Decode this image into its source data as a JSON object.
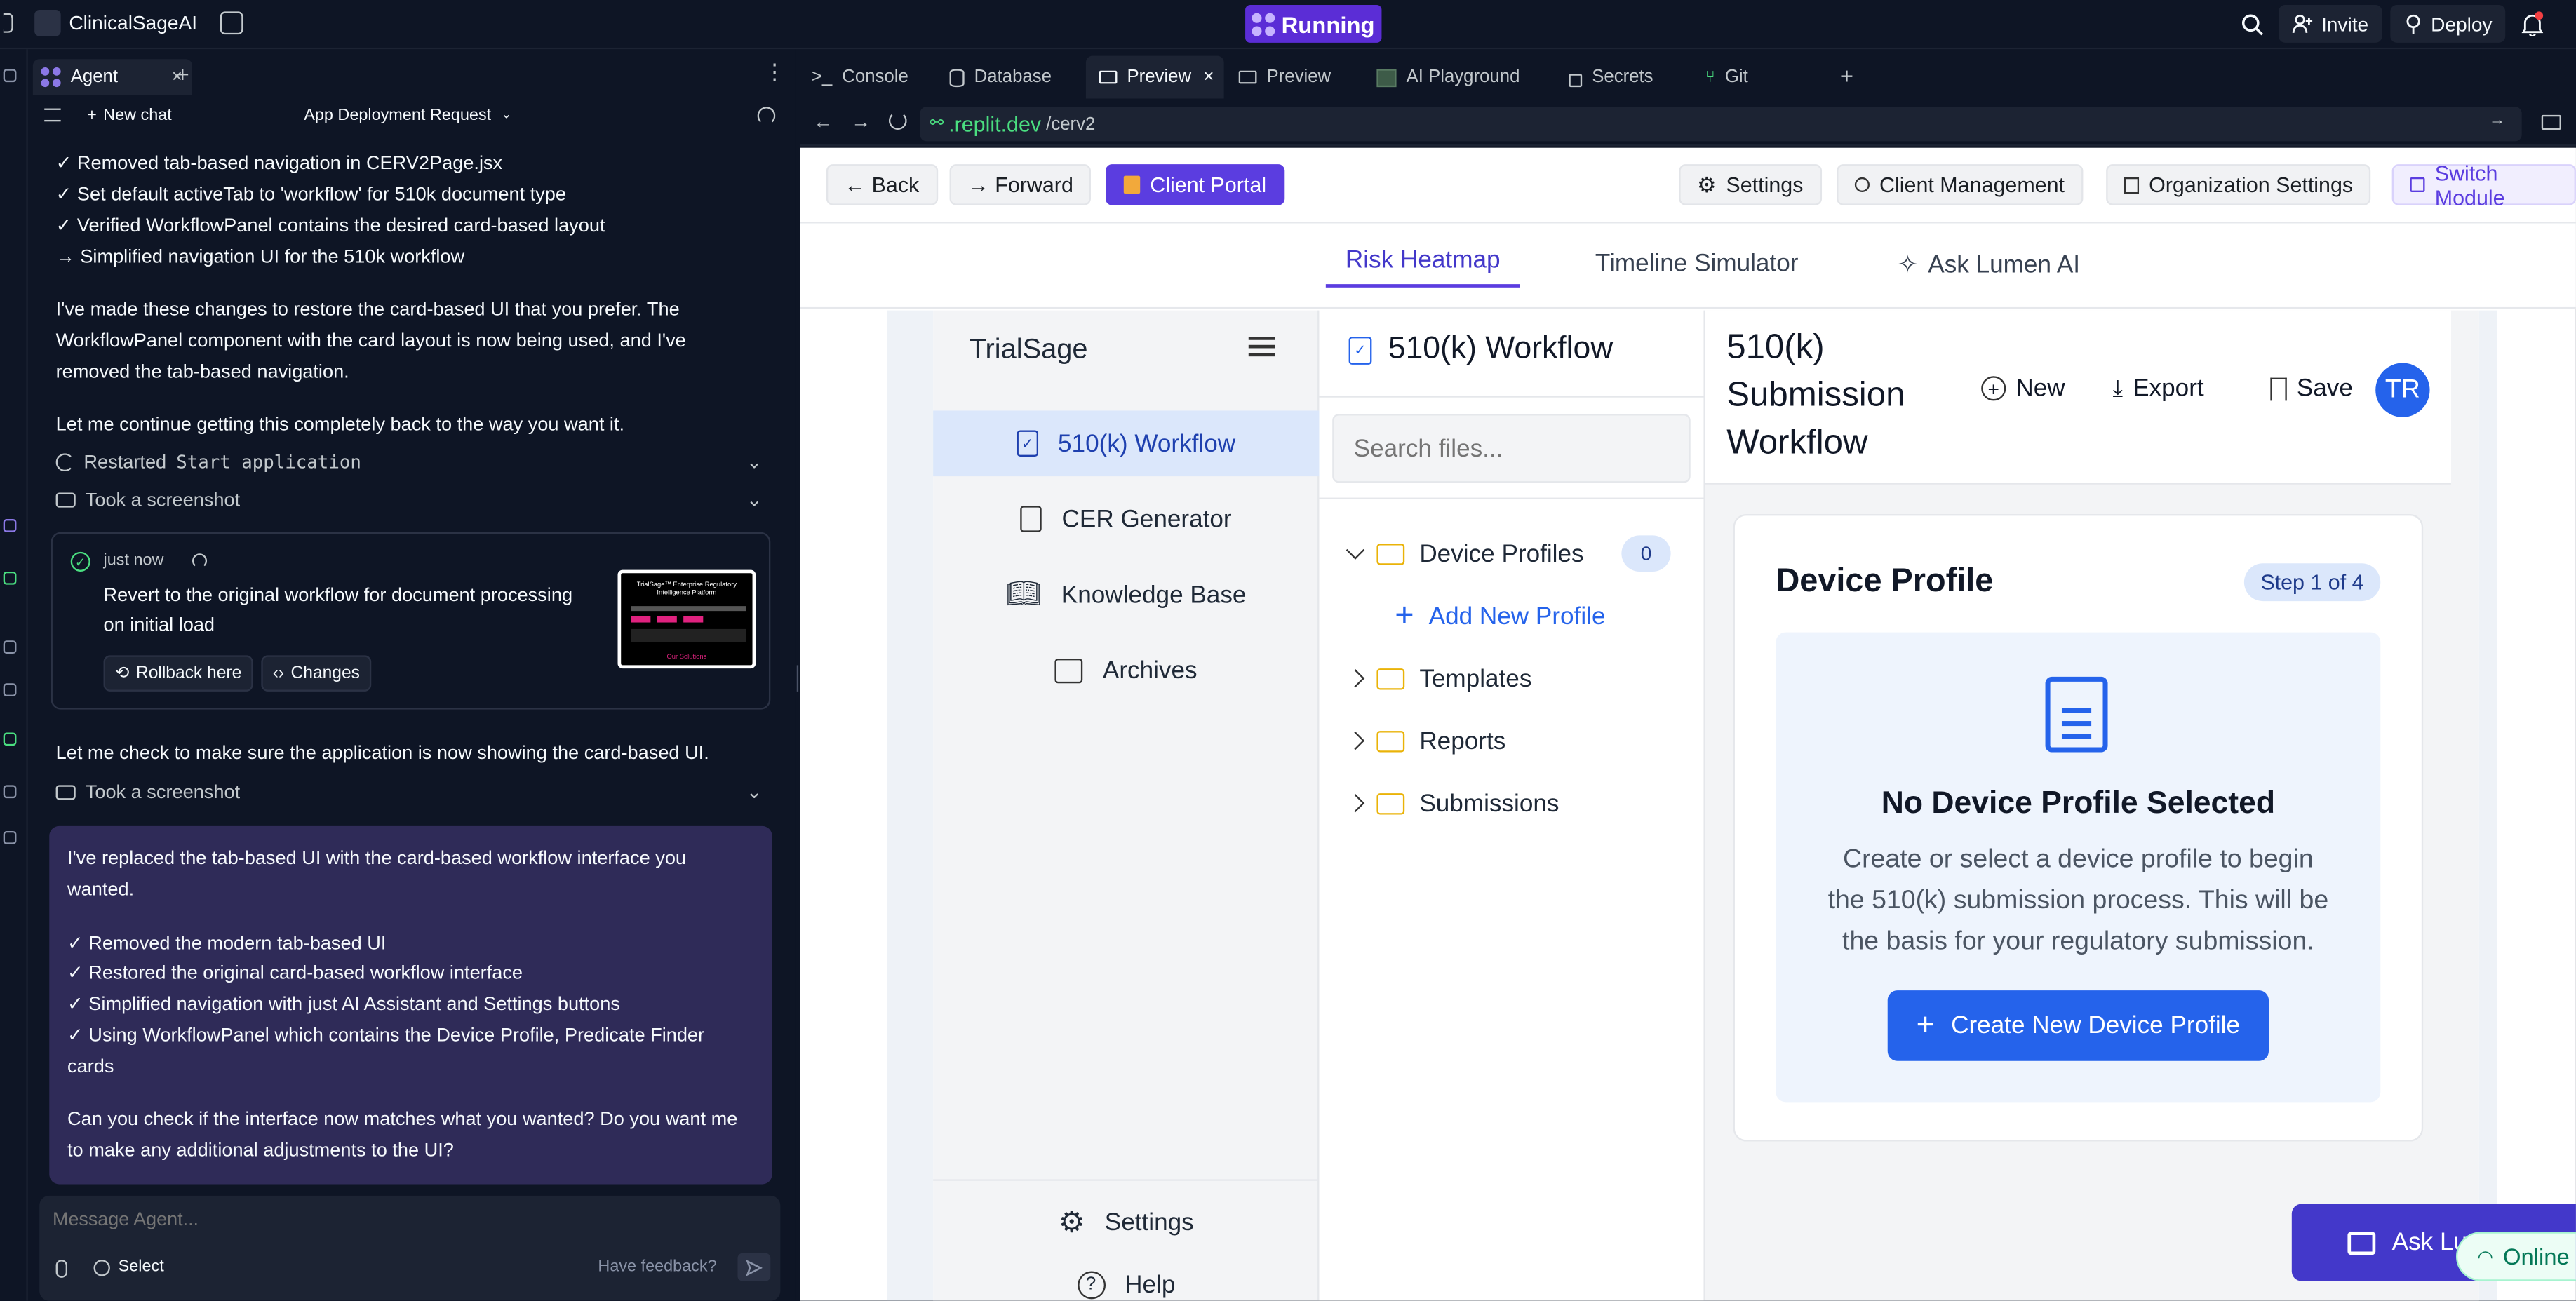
{
  "topbar": {
    "app_name": "ClinicalSageAI",
    "status": "Running",
    "invite": "Invite",
    "deploy": "Deploy"
  },
  "agent": {
    "tab_label": "Agent",
    "new_chat": "New chat",
    "chat_title": "App Deployment Request",
    "lines": [
      "✓ Removed tab-based navigation in CERV2Page.jsx",
      "✓ Set default activeTab to 'workflow' for 510k document type",
      "✓ Verified WorkflowPanel contains the desired card-based layout",
      "→ Simplified navigation UI for the 510k workflow"
    ],
    "para1_l1": "I've made these changes to restore the card-based UI that you prefer. The",
    "para1_l2": "WorkflowPanel component with the card layout is now being used, and I've",
    "para1_l3": "removed the tab-based navigation.",
    "para2": "Let me continue getting this completely back to the way you want it.",
    "restarted_prefix": "Restarted",
    "restarted_code": "Start application",
    "screenshot1": "Took a screenshot",
    "checkpoint_time": "just now",
    "checkpoint_l1": "Revert to the original workflow for document processing",
    "checkpoint_l2": "on initial load",
    "rollback": "Rollback here",
    "changes": "Changes",
    "thumb_title": "TrialSage™ Enterprise Regulatory Intelligence Platform",
    "thumb_footer": "Our Solutions",
    "para3": "Let me check to make sure the application is now showing the card-based UI.",
    "screenshot2": "Took a screenshot",
    "msg_l1": "I've replaced the tab-based UI with the card-based workflow interface you",
    "msg_l2": "wanted.",
    "msg_items": [
      "✓ Removed the modern tab-based UI",
      "✓ Restored the original card-based workflow interface",
      "✓ Simplified navigation with just AI Assistant and Settings buttons",
      "✓ Using WorkflowPanel which contains the Device Profile, Predicate Finder"
    ],
    "msg_item_cont": "cards",
    "msg_q1": "Can you check if the interface now matches what you wanted? Do you want me",
    "msg_q2": "to make any additional adjustments to the UI?",
    "input_placeholder": "Message Agent...",
    "select": "Select",
    "feedback": "Have feedback?"
  },
  "preview_tabs": [
    "Console",
    "Database",
    "Preview",
    "Preview",
    "AI Playground",
    "Secrets",
    "Git"
  ],
  "url": {
    "domain": ".replit.dev",
    "path": "/cerv2"
  },
  "app": {
    "back": "← Back",
    "forward": "→ Forward",
    "client_portal": "Client Portal",
    "settings": "Settings",
    "client_mgmt": "Client Management",
    "org_settings": "Organization Settings",
    "switch_module": "Switch Module",
    "nav": [
      "Risk Heatmap",
      "Timeline Simulator",
      "Ask Lumen AI"
    ],
    "brand": "TrialSage",
    "side_items": [
      "510(k) Workflow",
      "CER Generator",
      "Knowledge Base",
      "Archives"
    ],
    "side_settings": "Settings",
    "side_help": "Help",
    "files_title": "510(k) Workflow",
    "search_placeholder": "Search files...",
    "tree": [
      "Device Profiles",
      "Templates",
      "Reports",
      "Submissions"
    ],
    "device_count": "0",
    "add_new_profile": "Add New Profile",
    "main_title_l1": "510(k)",
    "main_title_l2": "Submission",
    "main_title_l3": "Workflow",
    "new": "New",
    "export": "Export",
    "save": "Save",
    "avatar": "TR",
    "card_title": "Device Profile",
    "step": "Step 1 of 4",
    "empty_title": "No Device Profile Selected",
    "empty_l1": "Create or select a device profile to begin",
    "empty_l2": "the 510(k) submission process. This will be",
    "empty_l3": "the basis for your regulatory submission.",
    "create_btn": "Create New Device Profile",
    "ask_btn": "Ask Lu",
    "online": "Online"
  },
  "colors": {
    "running": "#5b2dd6",
    "primary_blue": "#2563eb",
    "agent_msg": "#2f2b58",
    "url_green": "#4ade80"
  }
}
